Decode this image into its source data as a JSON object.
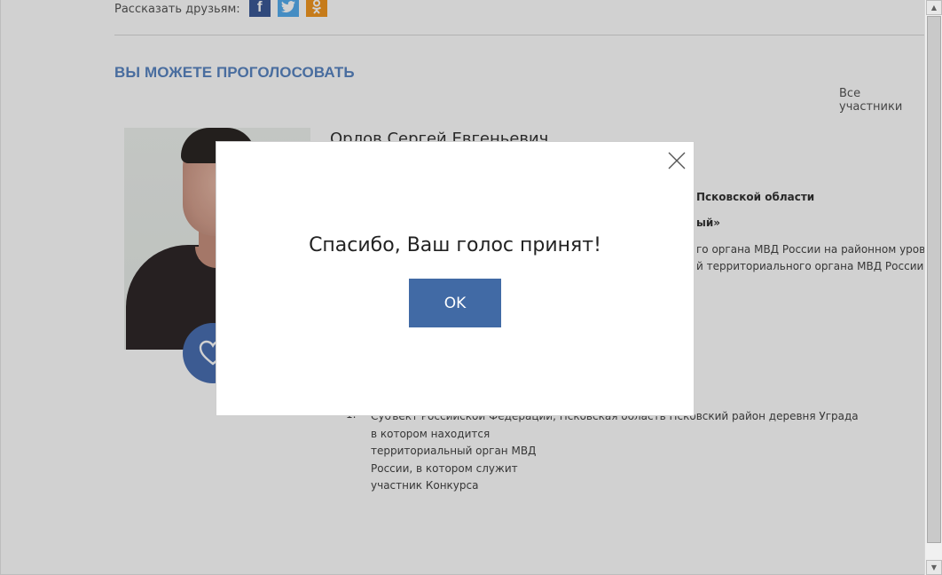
{
  "share": {
    "label": "Рассказать друзьям:",
    "networks": [
      {
        "name": "facebook",
        "icon": "facebook-icon",
        "glyph": "f",
        "color": "#3b5998"
      },
      {
        "name": "twitter",
        "icon": "twitter-icon",
        "glyph": "t",
        "color": "#55acee"
      },
      {
        "name": "odnoklassniki",
        "icon": "odnoklassniki-icon",
        "glyph": "ок",
        "color": "#f29620"
      }
    ]
  },
  "section": {
    "title": "ВЫ МОЖЕТЕ ПРОГОЛОСОВАТЬ",
    "all_link": "Все участники"
  },
  "participant": {
    "name": "Орлов Сергей Евгеньевич",
    "region_fragment": "Псковской области",
    "quote_fragment": "ый»",
    "position_line1": "го органа МВД России на районном уровн",
    "position_line2": "й территориального органа МВД России н",
    "list": {
      "number": "1.",
      "first_line": "Субъект Российской Федерации,   Псковская область Псковский район деревня Уграда",
      "lines": [
        "в котором находится",
        "территориальный орган  МВД",
        "России, в котором служит",
        "участник Конкурса"
      ]
    }
  },
  "modal": {
    "message": "Спасибо, Ваш голос принят!",
    "ok_label": "OK",
    "close_icon": "close-icon"
  },
  "colors": {
    "accent": "#5a86c2",
    "button": "#416aa5",
    "overlay": "rgba(0,0,0,0.18)"
  }
}
